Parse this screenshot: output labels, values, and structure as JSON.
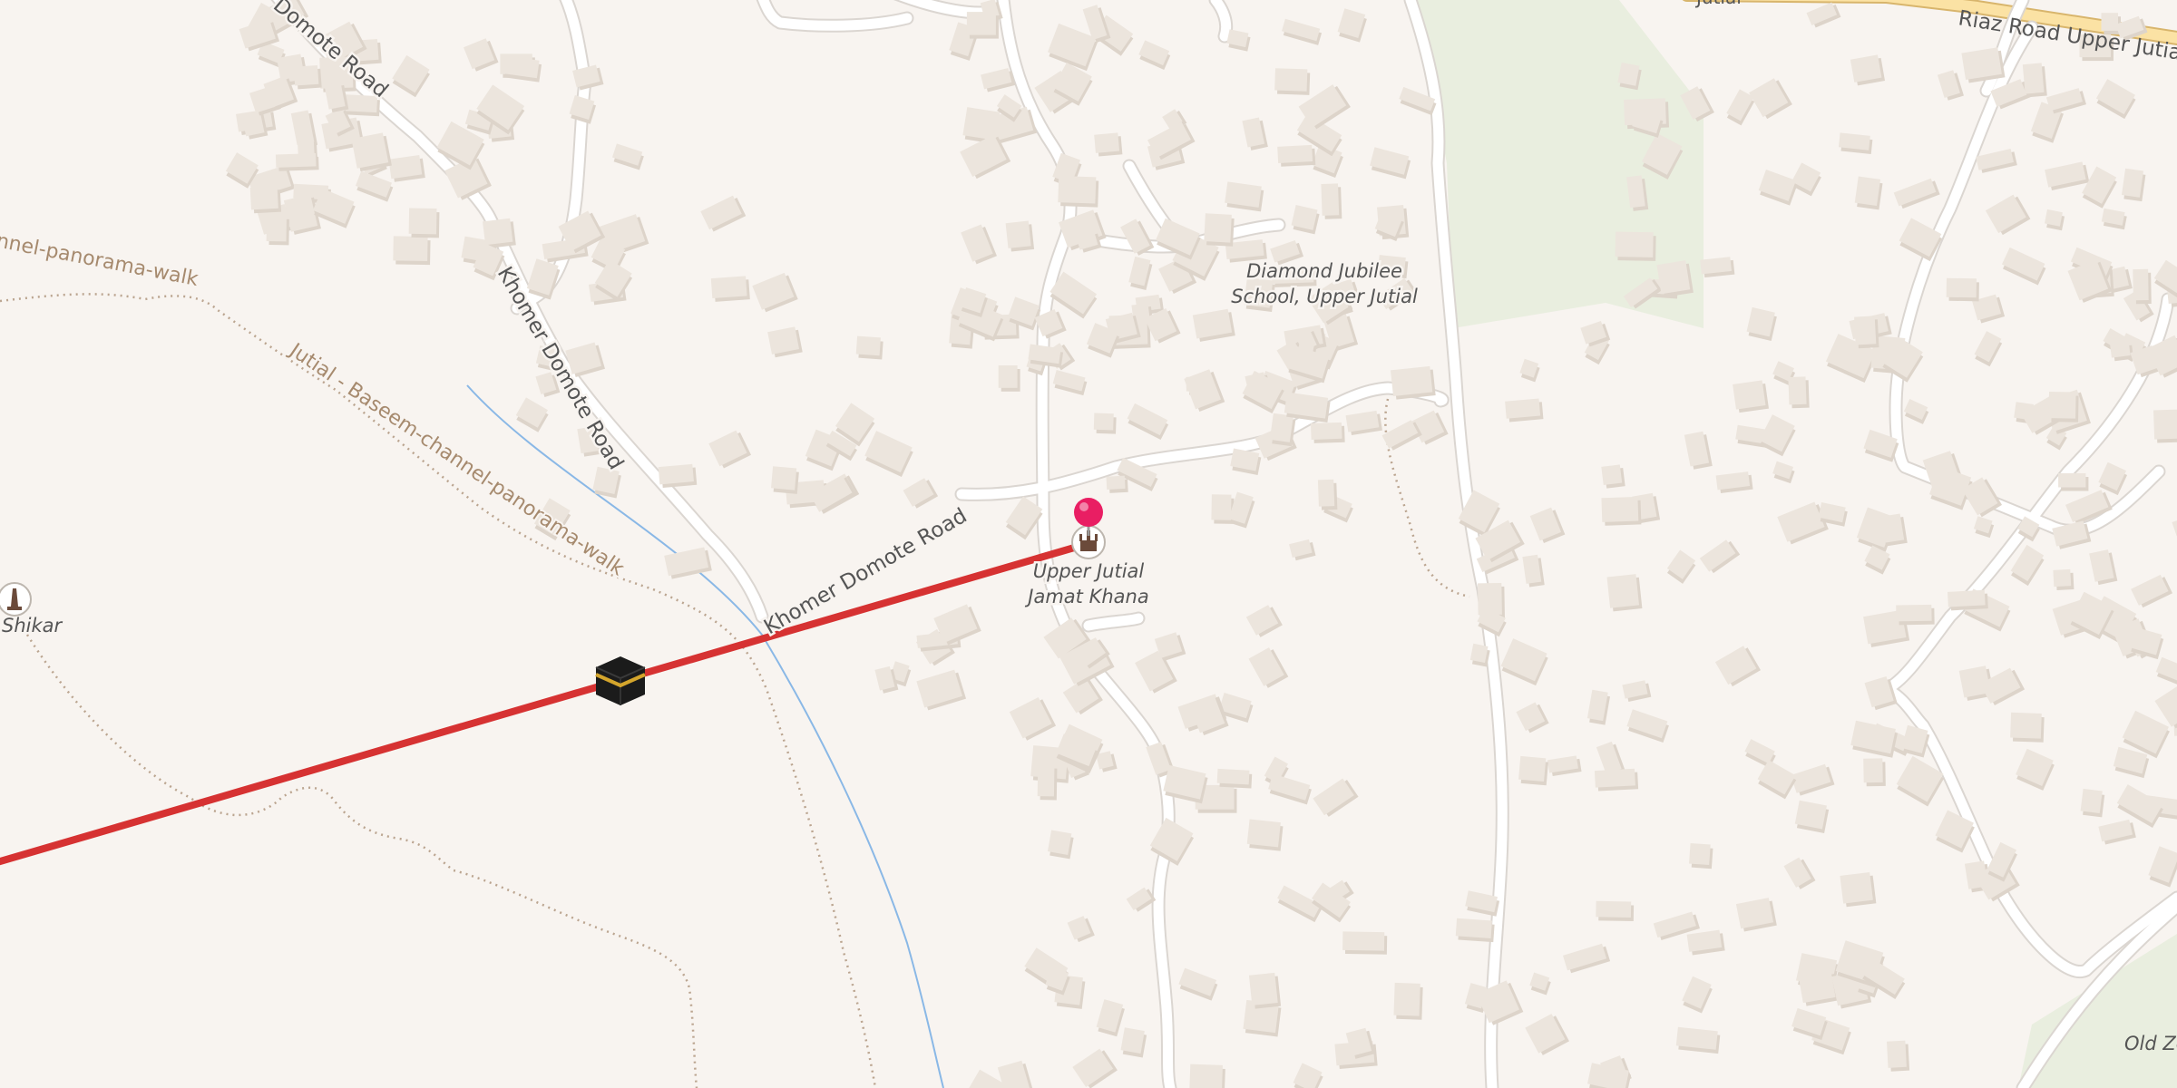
{
  "map": {
    "labels": {
      "khomer_domote_road_top": "Domote Road",
      "khomer_domote_road_middle": "Khomer Domote Road",
      "khomer_domote_road_lower": "Khomer Domote Road",
      "channel_walk_left": "nnel-panorama-walk",
      "jutial_baseem_walk": "Jutial - Baseem-channel-panorama-walk",
      "riaz_road": "Riaz Road Upper Jutial",
      "top_road_fragment": "Jutial",
      "diamond_jubilee_line1": "Diamond Jubilee",
      "diamond_jubilee_line2": "School, Upper Jutial",
      "jamat_khana_line1": "Upper Jutial",
      "jamat_khana_line2": "Jamat Khana",
      "shikar": "Shikar",
      "old_zone": "Old Zo"
    },
    "colors": {
      "background": "#f8f4f0",
      "park": "#e9eedf",
      "road_casing": "#dbd6d1",
      "road_fill": "#ffffff",
      "primary_road": "#fbe2a4",
      "building": "#ece5dd",
      "building_shadow": "#ddd4ca",
      "path": "#bba590",
      "stream": "#8ab8e6",
      "direction_line": "#d63232",
      "pin": "#e91e63",
      "map_label": "#555555",
      "walk_label": "#a68a6e"
    },
    "icons": {
      "kaaba": "kaaba-icon",
      "pin": "location-pin-icon",
      "place_of_worship": "place-of-worship-icon",
      "monument": "monument-icon"
    }
  }
}
